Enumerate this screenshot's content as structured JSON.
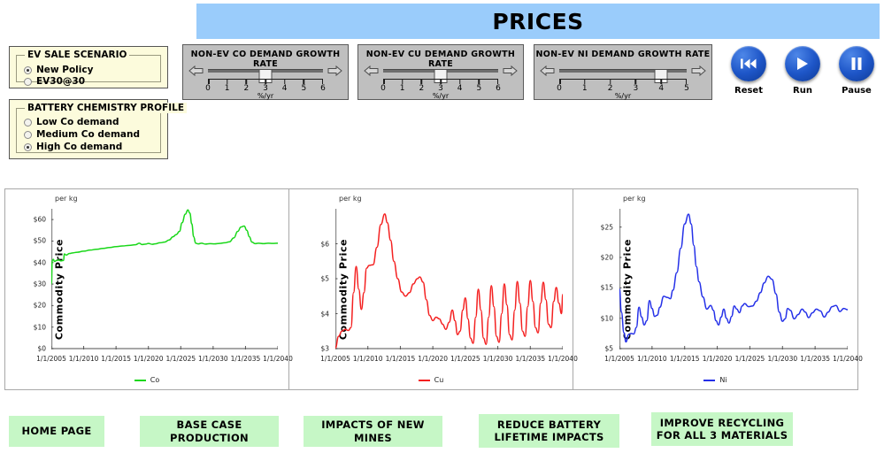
{
  "header": {
    "title": "PRICES",
    "banner_color": "#9ACCFB"
  },
  "ev_scenario": {
    "legend": "EV SALE SCENARIO",
    "options": [
      {
        "label": "New Policy",
        "selected": true
      },
      {
        "label": "EV30@30",
        "selected": false
      }
    ]
  },
  "battery_profile": {
    "legend": "BATTERY CHEMISTRY PROFILE",
    "options": [
      {
        "label": "Low Co demand",
        "selected": false
      },
      {
        "label": "Medium Co demand",
        "selected": false
      },
      {
        "label": "High Co demand",
        "selected": true
      }
    ]
  },
  "sliders": [
    {
      "title": "NON-EV CO DEMAND GROWTH RATE",
      "unit": "%/yr",
      "min": 0,
      "max": 6,
      "value": 3,
      "ticks": [
        "0",
        "1",
        "2",
        "3",
        "4",
        "5",
        "6"
      ]
    },
    {
      "title": "NON-EV CU DEMAND GROWTH RATE",
      "unit": "%/yr",
      "min": 0,
      "max": 6,
      "value": 3,
      "ticks": [
        "0",
        "1",
        "2",
        "3",
        "4",
        "5",
        "6"
      ]
    },
    {
      "title": "NON-EV NI DEMAND GROWTH RATE",
      "unit": "%/yr",
      "min": 0,
      "max": 5,
      "value": 4,
      "ticks": [
        "0",
        "1",
        "2",
        "3",
        "4",
        "5"
      ]
    }
  ],
  "transport": [
    {
      "label": "Reset",
      "icon": "skip-back-icon"
    },
    {
      "label": "Run",
      "icon": "play-icon"
    },
    {
      "label": "Pause",
      "icon": "pause-icon"
    }
  ],
  "nav_buttons": [
    {
      "lines": [
        "HOME PAGE"
      ]
    },
    {
      "lines": [
        "BASE CASE PRODUCTION"
      ]
    },
    {
      "lines": [
        "IMPACTS OF NEW MINES"
      ]
    },
    {
      "lines": [
        "REDUCE BATTERY",
        "LIFETIME IMPACTS"
      ]
    },
    {
      "lines": [
        "IMPROVE RECYCLING",
        "FOR ALL 3 MATERIALS"
      ]
    }
  ],
  "chart_data": [
    {
      "type": "line",
      "title": "",
      "unit_note": "per kg",
      "ylabel": "Commodity  Price",
      "xlabel": "",
      "color": "#19D719",
      "legend": [
        "Co"
      ],
      "legend_position": "bottom",
      "grid": false,
      "ylim": [
        0,
        65
      ],
      "yticks": [
        0,
        10,
        20,
        30,
        40,
        50,
        60
      ],
      "ytick_labels": [
        "$0",
        "$10",
        "$20",
        "$30",
        "$40",
        "$50",
        "$60"
      ],
      "xlim": [
        "1/1/2005",
        "1/1/2040"
      ],
      "xtick_labels": [
        "1/1/2005",
        "1/1/2010",
        "1/1/2015",
        "1/1/2020",
        "1/1/2025",
        "1/1/2030",
        "1/1/2035",
        "1/1/2040"
      ],
      "series": [
        {
          "name": "Co",
          "x": [
            2005.0,
            2005.15,
            2005.3,
            2005.5,
            2005.8,
            2006.1,
            2006.5,
            2006.9,
            2007.0,
            2007.3,
            2007.8,
            2008.3,
            2009.0,
            2010.0,
            2011.0,
            2012.0,
            2013.0,
            2014.0,
            2015.0,
            2016.0,
            2017.0,
            2018.0,
            2018.6,
            2019.0,
            2019.6,
            2020.0,
            2020.6,
            2021.0,
            2021.8,
            2022.5,
            2023.2,
            2023.8,
            2024.3,
            2024.8,
            2025.2,
            2025.7,
            2026.1,
            2026.4,
            2026.7,
            2027.0,
            2027.3,
            2027.7,
            2028.2,
            2028.8,
            2029.5,
            2030.2,
            2031.0,
            2031.8,
            2032.5,
            2033.2,
            2033.8,
            2034.3,
            2034.8,
            2035.2,
            2035.6,
            2036.0,
            2036.5,
            2037.0,
            2037.8,
            2038.5,
            2039.2,
            2040.0
          ],
          "y": [
            30.0,
            41.0,
            41.5,
            40.5,
            41.0,
            41.2,
            40.8,
            41.0,
            44.0,
            43.5,
            44.2,
            44.5,
            44.8,
            45.3,
            45.8,
            46.2,
            46.6,
            47.0,
            47.4,
            47.7,
            48.0,
            48.3,
            49.0,
            48.4,
            48.6,
            48.9,
            48.5,
            48.7,
            49.2,
            49.5,
            50.5,
            52.0,
            53.0,
            54.5,
            58.5,
            62.5,
            64.5,
            63.0,
            58.0,
            52.0,
            49.0,
            48.7,
            49.0,
            48.6,
            48.8,
            48.7,
            48.9,
            49.2,
            49.6,
            51.5,
            54.5,
            56.5,
            57.0,
            55.0,
            52.0,
            49.5,
            48.8,
            49.0,
            48.8,
            49.0,
            48.9,
            49.0
          ]
        }
      ]
    },
    {
      "type": "line",
      "title": "",
      "unit_note": "per kg",
      "ylabel": "Commodity  Price",
      "xlabel": "",
      "color": "#F42020",
      "legend": [
        "Cu"
      ],
      "legend_position": "bottom",
      "grid": false,
      "ylim": [
        3,
        7.0
      ],
      "yticks": [
        3,
        4,
        5,
        6
      ],
      "ytick_labels": [
        "$3",
        "$4",
        "$5",
        "$6"
      ],
      "xlim": [
        "1/1/2005",
        "1/1/2040"
      ],
      "xtick_labels": [
        "1/1/2005",
        "1/1/2010",
        "1/1/2015",
        "1/1/2020",
        "1/1/2025",
        "1/1/2030",
        "1/1/2035",
        "1/1/2040"
      ],
      "series": [
        {
          "name": "Cu",
          "x": [
            2005.0,
            2005.5,
            2006.0,
            2006.5,
            2007.0,
            2007.4,
            2007.8,
            2008.2,
            2008.6,
            2009.0,
            2009.4,
            2009.8,
            2010.2,
            2010.8,
            2011.4,
            2012.0,
            2012.6,
            2013.0,
            2013.5,
            2014.0,
            2014.6,
            2015.2,
            2015.8,
            2016.4,
            2017.0,
            2017.6,
            2018.0,
            2018.5,
            2019.0,
            2019.5,
            2020.0,
            2020.5,
            2021.0,
            2021.5,
            2022.0,
            2022.5,
            2023.0,
            2023.4,
            2023.8,
            2024.2,
            2024.6,
            2025.0,
            2025.4,
            2025.8,
            2026.2,
            2026.6,
            2027.0,
            2027.4,
            2027.8,
            2028.2,
            2028.6,
            2029.0,
            2029.4,
            2029.8,
            2030.2,
            2030.6,
            2031.0,
            2031.4,
            2031.8,
            2032.2,
            2032.6,
            2033.0,
            2033.4,
            2033.8,
            2034.2,
            2034.6,
            2035.0,
            2035.4,
            2035.8,
            2036.2,
            2036.6,
            2037.0,
            2037.4,
            2037.8,
            2038.2,
            2038.6,
            2039.0,
            2039.4,
            2039.8,
            2040.0
          ],
          "y": [
            3.02,
            3.35,
            3.5,
            3.55,
            3.52,
            3.6,
            4.6,
            5.35,
            4.7,
            4.12,
            4.6,
            5.3,
            5.38,
            5.4,
            5.9,
            6.55,
            6.85,
            6.6,
            6.1,
            5.5,
            5.0,
            4.62,
            4.5,
            4.6,
            4.85,
            5.0,
            5.05,
            4.9,
            4.4,
            3.95,
            3.8,
            3.9,
            3.85,
            3.7,
            3.55,
            3.75,
            4.1,
            3.8,
            3.4,
            3.5,
            4.1,
            4.45,
            3.85,
            3.3,
            3.15,
            3.9,
            4.7,
            4.1,
            3.3,
            3.12,
            3.9,
            4.8,
            4.2,
            3.35,
            3.18,
            4.0,
            4.85,
            4.25,
            3.4,
            3.25,
            4.1,
            4.92,
            4.3,
            3.5,
            3.35,
            4.2,
            4.95,
            4.35,
            3.6,
            3.45,
            4.3,
            4.9,
            4.4,
            3.7,
            3.6,
            4.35,
            4.75,
            4.3,
            4.0,
            4.55
          ]
        }
      ]
    },
    {
      "type": "line",
      "title": "",
      "unit_note": "per kg",
      "ylabel": "Commodity  Price",
      "xlabel": "",
      "color": "#2430E8",
      "legend": [
        "Ni"
      ],
      "legend_position": "bottom",
      "grid": false,
      "ylim": [
        5,
        28
      ],
      "yticks": [
        5,
        10,
        15,
        20,
        25
      ],
      "ytick_labels": [
        "$5",
        "$10",
        "$15",
        "$20",
        "$25"
      ],
      "xlim": [
        "1/1/2005",
        "1/1/2040"
      ],
      "xtick_labels": [
        "1/1/2005",
        "1/1/2010",
        "1/1/2015",
        "1/1/2020",
        "1/1/2025",
        "1/1/2030",
        "1/1/2035",
        "1/1/2040"
      ],
      "series": [
        {
          "name": "Ni",
          "x": [
            2005.0,
            2005.3,
            2005.7,
            2006.0,
            2006.4,
            2006.8,
            2007.2,
            2007.6,
            2008.0,
            2008.4,
            2008.8,
            2009.2,
            2009.6,
            2010.0,
            2010.4,
            2010.8,
            2011.2,
            2011.8,
            2012.4,
            2012.8,
            2013.2,
            2013.8,
            2014.4,
            2015.0,
            2015.6,
            2016.0,
            2016.4,
            2016.8,
            2017.2,
            2017.8,
            2018.4,
            2019.0,
            2019.4,
            2019.8,
            2020.2,
            2020.6,
            2021.0,
            2021.4,
            2021.8,
            2022.2,
            2022.6,
            2023.0,
            2023.4,
            2023.8,
            2024.2,
            2024.8,
            2025.4,
            2026.0,
            2026.6,
            2027.2,
            2027.8,
            2028.4,
            2029.0,
            2029.5,
            2030.0,
            2030.4,
            2030.8,
            2031.2,
            2031.8,
            2032.4,
            2033.0,
            2033.5,
            2034.0,
            2034.6,
            2035.2,
            2035.8,
            2036.4,
            2037.0,
            2037.6,
            2038.2,
            2038.8,
            2039.4,
            2040.0
          ],
          "y": [
            14.8,
            11.0,
            7.6,
            6.1,
            7.3,
            7.5,
            7.4,
            8.5,
            11.8,
            10.2,
            8.9,
            9.6,
            12.9,
            11.6,
            10.3,
            10.5,
            11.8,
            13.6,
            13.4,
            13.2,
            14.6,
            17.5,
            21.5,
            25.5,
            27.1,
            25.5,
            22.0,
            18.5,
            16.0,
            13.5,
            11.5,
            12.1,
            11.3,
            9.6,
            8.9,
            10.2,
            11.5,
            10.0,
            9.2,
            10.3,
            12.0,
            11.5,
            10.9,
            12.0,
            12.4,
            11.9,
            12.0,
            12.8,
            14.2,
            15.8,
            16.9,
            16.4,
            14.0,
            11.0,
            9.5,
            9.9,
            11.6,
            11.3,
            9.9,
            10.6,
            11.5,
            11.0,
            10.1,
            10.9,
            11.5,
            11.2,
            10.2,
            11.0,
            11.9,
            12.1,
            11.1,
            11.6,
            11.4
          ]
        }
      ]
    }
  ]
}
